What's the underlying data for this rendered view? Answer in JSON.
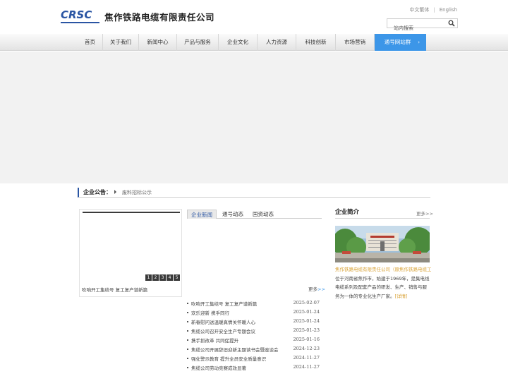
{
  "header": {
    "logo_mark": "CRSC",
    "company_name": "焦作铁路电缆有限责任公司",
    "lang_cn": "中文繁体",
    "lang_sep": "|",
    "lang_en": "English",
    "search_placeholder": "站内搜索",
    "search_icon": "search-icon"
  },
  "nav": {
    "items": [
      {
        "label": "首页"
      },
      {
        "label": "关于我们"
      },
      {
        "label": "新闻中心"
      },
      {
        "label": "产品与服务"
      },
      {
        "label": "企业文化"
      },
      {
        "label": "人力资源"
      },
      {
        "label": "科技创新"
      },
      {
        "label": "市场营销"
      },
      {
        "label": "通号网站群",
        "arrow": "›"
      }
    ],
    "active_color": "#3c96e8"
  },
  "notice": {
    "label": "企业公告：",
    "text": "废料招标公示"
  },
  "slider": {
    "dots": [
      "1",
      "2",
      "3",
      "4",
      "5"
    ],
    "caption": "吹响开工集结号 复工复产谱新篇"
  },
  "tabs": [
    {
      "label": "企业新闻"
    },
    {
      "label": "通号动态"
    },
    {
      "label": "国资动态"
    }
  ],
  "news": {
    "more_label": "更多",
    "more_suffix": ">>",
    "items": [
      {
        "title": "吹响开工集结号 复工复产谱新篇",
        "date": "2025-02-07"
      },
      {
        "title": "欢乐迎新 携手同行",
        "date": "2025-01-24"
      },
      {
        "title": "新春慰问送温暖真情关怀暖人心",
        "date": "2025-01-24"
      },
      {
        "title": "焦缆公司召开安全生产专题会议",
        "date": "2025-01-23"
      },
      {
        "title": "携手抓改革 共同促提升",
        "date": "2025-01-16"
      },
      {
        "title": "焦缆公司开展辞旧迎新主题读书会暨座谈会",
        "date": "2024-12-23"
      },
      {
        "title": "强化警示教育 提升全员安全质量意识",
        "date": "2024-11-27"
      },
      {
        "title": "焦缆公司劳动竞赛成效显著",
        "date": "2024-11-27"
      }
    ]
  },
  "profile": {
    "title": "企业简介",
    "more_label": "更多>>",
    "highlight": "焦作铁路电缆有限责任公司（原焦作铁路电缆工厂）",
    "body": "位于河南省焦作市，始建于1969年，是集电线电缆系列及配套产品的研发、生产、销售与服务为一体的专业化生产厂家。",
    "detail_label": "[详情]"
  }
}
